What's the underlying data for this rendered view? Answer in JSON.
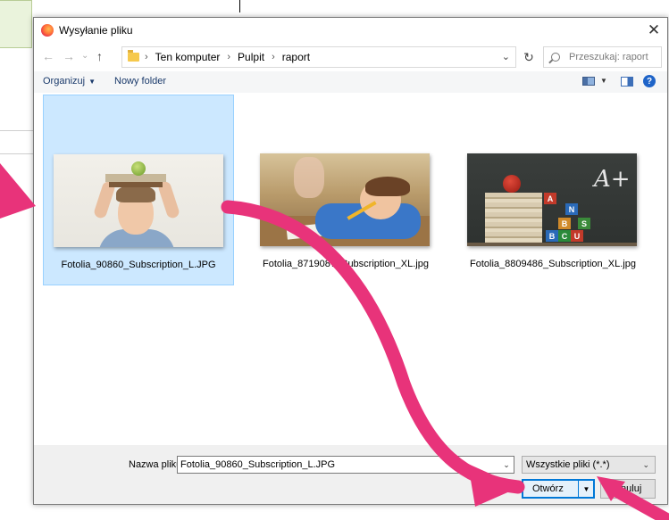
{
  "dialog": {
    "title": "Wysyłanie pliku",
    "close": "✕"
  },
  "nav": {
    "back": "←",
    "forward": "→",
    "recent": "⌄",
    "up": "↑",
    "breadcrumbs": [
      "Ten komputer",
      "Pulpit",
      "raport"
    ],
    "separator": "›",
    "dropdown": "⌄",
    "refresh": "↻",
    "search_placeholder": "Przeszukaj: raport"
  },
  "toolbar": {
    "organize": "Organizuj",
    "organize_caret": "▼",
    "new_folder": "Nowy folder",
    "view_caret": "▼",
    "help": "?"
  },
  "files": [
    {
      "name": "Fotolia_90860_Subscription_L.JPG",
      "selected": true
    },
    {
      "name": "Fotolia_8719087_Subscription_XL.jpg",
      "selected": false
    },
    {
      "name": "Fotolia_8809486_Subscription_XL.jpg",
      "selected": false
    }
  ],
  "thumb3": {
    "aplus": "A+",
    "blocks": [
      "A",
      "B",
      "C",
      "U",
      "N",
      "S",
      "B"
    ]
  },
  "bottom": {
    "filename_label": "Nazwa pliku:",
    "filename_value": "Fotolia_90860_Subscription_L.JPG",
    "filename_caret": "⌄",
    "filetype_value": "Wszystkie pliki (*.*)",
    "filetype_caret": "⌄",
    "open_label": "Otwórz",
    "open_caret": "▼",
    "cancel_label": "Anuluj"
  },
  "colors": {
    "accent": "#0078d7",
    "selection": "#cce8ff",
    "annotation_arrow": "#e8337a"
  }
}
